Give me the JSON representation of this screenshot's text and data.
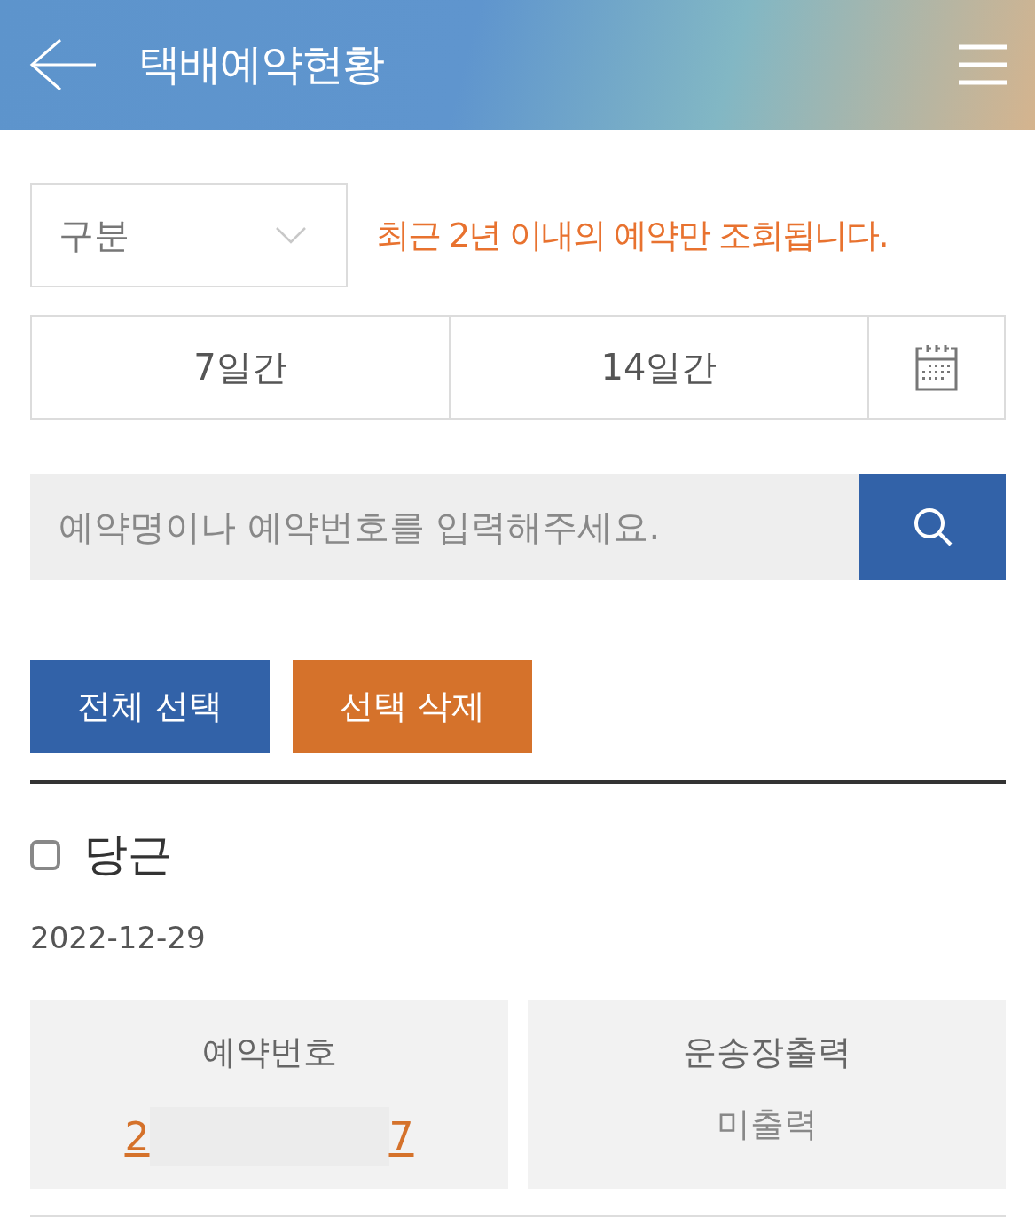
{
  "header": {
    "title": "택배예약현황"
  },
  "filter": {
    "dropdown": {
      "placeholder": "구분"
    },
    "notice": "최근 2년 이내의 예약만 조회됩니다."
  },
  "periods": [
    {
      "label": "7일간",
      "selected": false
    },
    {
      "label": "14일간",
      "selected": false
    }
  ],
  "search": {
    "placeholder": "예약명이나 예약번호를 입력해주세요."
  },
  "actions": [
    {
      "label": "전체 선택",
      "kind": "primary"
    },
    {
      "label": "선택 삭제",
      "kind": "danger"
    }
  ],
  "reservations": [
    {
      "name": "당근",
      "checked": false,
      "date": "2022-12-29",
      "number_label": "예약번호",
      "number_start": "2",
      "number_end": "7",
      "waybill_label": "운송장출력",
      "waybill_status": "미출력"
    }
  ]
}
